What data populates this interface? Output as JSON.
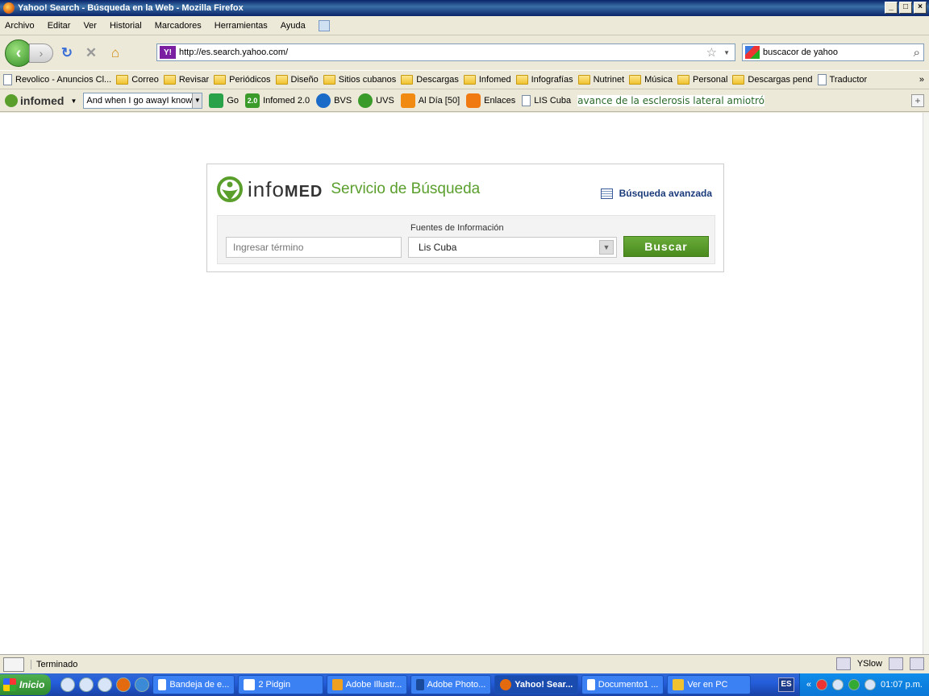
{
  "window": {
    "title": "Yahoo! Search - Búsqueda en la Web - Mozilla Firefox",
    "controls": [
      "_",
      "□",
      "×"
    ]
  },
  "menu": [
    "Archivo",
    "Editar",
    "Ver",
    "Historial",
    "Marcadores",
    "Herramientas",
    "Ayuda"
  ],
  "nav": {
    "url": "http://es.search.yahoo.com/",
    "search_value": "buscacor de yahoo"
  },
  "bookmarks": [
    {
      "label": "Revolico - Anuncios Cl...",
      "type": "page"
    },
    {
      "label": "Correo",
      "type": "folder"
    },
    {
      "label": "Revisar",
      "type": "folder"
    },
    {
      "label": "Periódicos",
      "type": "folder"
    },
    {
      "label": "Diseño",
      "type": "folder"
    },
    {
      "label": "Sitios cubanos",
      "type": "folder"
    },
    {
      "label": "Descargas",
      "type": "folder"
    },
    {
      "label": "Infomed",
      "type": "folder"
    },
    {
      "label": "Infografías",
      "type": "folder"
    },
    {
      "label": "Nutrinet",
      "type": "folder"
    },
    {
      "label": "Música",
      "type": "folder"
    },
    {
      "label": "Personal",
      "type": "folder"
    },
    {
      "label": "Descargas pend",
      "type": "folder"
    },
    {
      "label": "Traductor",
      "type": "page"
    }
  ],
  "bookmarks_more": "»",
  "infomed_toolbar": {
    "logo": "infomed",
    "combo_value": "And when I go awayI know",
    "go": "Go",
    "items": [
      "Infomed 2.0",
      "BVS",
      "UVS",
      "Al Día [50]",
      "Enlaces",
      "LIS Cuba"
    ],
    "badge_20": "2.0",
    "ticker": "avance de la esclerosis lateral amiotróp"
  },
  "page": {
    "brand_word": "info",
    "brand_med": "MED",
    "brand_service": "Servicio de Búsqueda",
    "advanced_link": "Búsqueda avanzada",
    "sources_label": "Fuentes de Información",
    "term_placeholder": "Ingresar término",
    "source_selected": "Lis Cuba",
    "search_button": "Buscar",
    "accent_color": "#5a9e2c"
  },
  "status": {
    "text": "Terminado",
    "yslow": "YSlow"
  },
  "taskbar": {
    "start": "Inicio",
    "tasks": [
      {
        "label": "Bandeja de e...",
        "active": false
      },
      {
        "label": "2 Pidgin",
        "active": false
      },
      {
        "label": "Adobe Illustr...",
        "active": false
      },
      {
        "label": "Adobe Photo...",
        "active": false
      },
      {
        "label": "Yahoo! Sear...",
        "active": true
      },
      {
        "label": "Documento1 ...",
        "active": false
      },
      {
        "label": "Ver en PC",
        "active": false
      }
    ],
    "lang": "ES",
    "tray_chevron": "«",
    "clock": "01:07 p.m."
  }
}
